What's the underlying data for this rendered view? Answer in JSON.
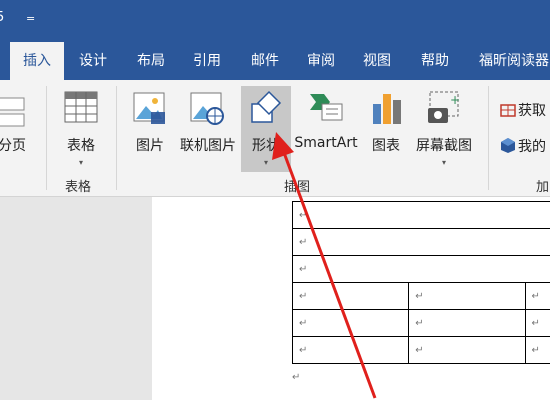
{
  "title_bar": {
    "qa_symbol": "=",
    "app_glyph": "5"
  },
  "tabs": [
    {
      "label": "插入",
      "active": true
    },
    {
      "label": "设计"
    },
    {
      "label": "布局"
    },
    {
      "label": "引用"
    },
    {
      "label": "邮件"
    },
    {
      "label": "审阅"
    },
    {
      "label": "视图"
    },
    {
      "label": "帮助"
    },
    {
      "label": "福昕阅读器"
    }
  ],
  "ribbon": {
    "page_break": "分页",
    "table": {
      "label": "表格",
      "group": "表格"
    },
    "illustrations": {
      "group": "插图",
      "picture": "图片",
      "online_picture": "联机图片",
      "shapes": "形状",
      "smartart": "SmartArt",
      "chart": "图表",
      "screenshot": "屏幕截图"
    },
    "addins": {
      "get": "获取",
      "my": "我的",
      "group": "加"
    },
    "caret": "▾"
  },
  "document": {
    "para_mark": "↵",
    "rows": [
      [
        "↵"
      ],
      [
        "↵"
      ],
      [
        "↵"
      ],
      [
        "↵",
        "↵",
        "↵"
      ],
      [
        "↵",
        "↵",
        "↵"
      ],
      [
        "↵",
        "↵",
        "↵"
      ]
    ]
  },
  "colors": {
    "accent": "#2b579a",
    "arrow": "#e0201c"
  }
}
